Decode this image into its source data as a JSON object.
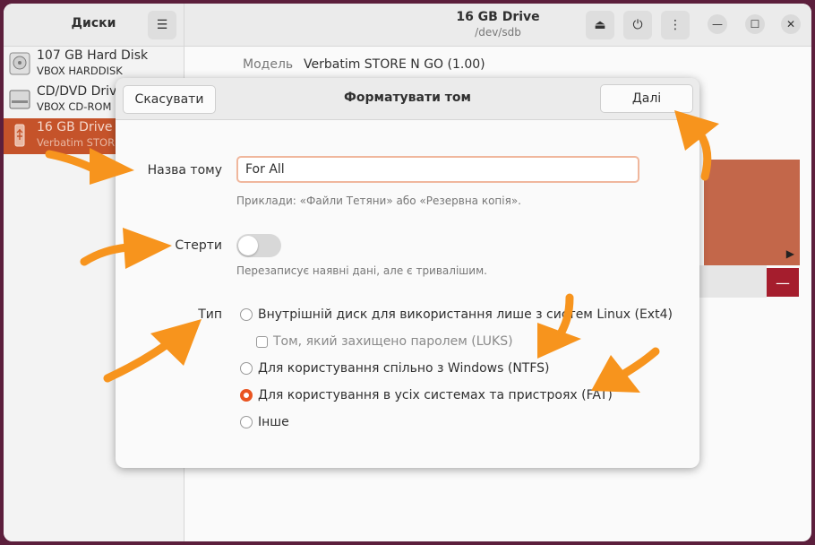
{
  "app": {
    "sidebar_title": "Диски",
    "drive_title": "16 GB Drive",
    "drive_path": "/dev/sdb"
  },
  "devices": [
    {
      "name": "107 GB Hard Disk",
      "sub": "VBOX HARDDISK",
      "icon": "hard-disk-icon"
    },
    {
      "name": "CD/DVD Drive",
      "sub": "VBOX CD-ROM",
      "icon": "optical-drive-icon"
    },
    {
      "name": "16 GB Drive",
      "sub": "Verbatim STORE",
      "icon": "usb-drive-icon",
      "selected": true
    }
  ],
  "details": {
    "model_label": "Модель",
    "model_value": "Verbatim STORE N GO (1.00)"
  },
  "dialog": {
    "title": "Форматувати том",
    "cancel_label": "Скасувати",
    "next_label": "Далі",
    "name_label": "Назва тому",
    "name_value": "For All",
    "name_hint": "Приклади: «Файли Тетяни» або «Резервна копія».",
    "erase_label": "Стерти",
    "erase_on": false,
    "erase_hint": "Перезаписує наявні дані, але є тривалішим.",
    "type_label": "Тип",
    "options": [
      {
        "label": "Внутрішній диск для використання лише з систем Linux (Ext4)",
        "selected": false
      },
      {
        "label": "Том, який захищено паролем (LUKS)",
        "disabled": true,
        "checkbox": true
      },
      {
        "label": "Для користування спільно з Windows (NTFS)",
        "selected": false
      },
      {
        "label": "Для користування в усіх системах та пристроях (FAT)",
        "selected": true
      },
      {
        "label": "Інше",
        "selected": false
      }
    ]
  },
  "colors": {
    "accent": "#e95420",
    "selection": "#c5532a",
    "arrow": "#f7941d",
    "desktop": "#5c1f3c",
    "danger": "#a51d2d"
  }
}
